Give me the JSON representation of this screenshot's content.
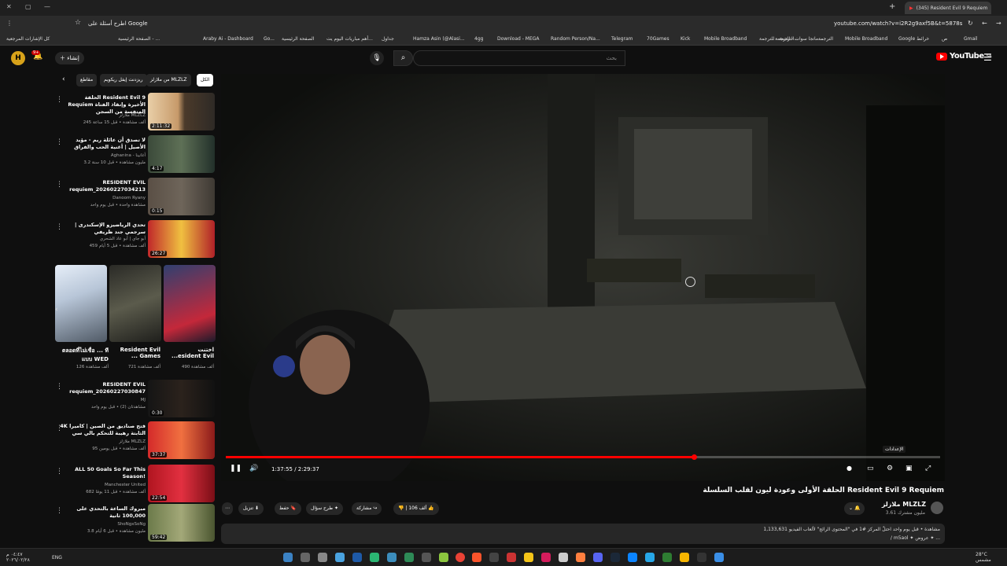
{
  "browser": {
    "tab_title": "(345) Resident Evil 9 Requiem",
    "url": "youtube.com/watch?v=i2R2g9axf5B&t=5878s",
    "ask_google": "اطرح أسئلة على Google",
    "bookmarks": [
      "كل الإشارات المرجعية",
      "الصفحة الرئيسية - ...",
      "Araby Ai - Dashboard",
      "Go...",
      "الصفحة الرئيسية",
      "أهم مباريات اليوم يت...",
      "جداول",
      "Hamza Asin (@Alasi...",
      "4gg",
      "Download - MEGA",
      "Random Person/Na...",
      "Telegram",
      "70Games",
      "Kick",
      "Mobile Broadband",
      "الترجمة - للترجمة...",
      "ماتجا سوات - للترجمة...",
      "الترجمة",
      "Mobile Broadband",
      "Google خرائط",
      "ص",
      "Gmail"
    ]
  },
  "yt": {
    "logo": "YouTube",
    "region": "SA",
    "search_placeholder": "بحث",
    "create_label": "إنشاء",
    "notif_count": "9+",
    "avatar_letter": "H"
  },
  "chips": [
    "الكل",
    "من ملازلز MLZLZ",
    "ريزدنت إيفل ريكويم",
    "مقاطع"
  ],
  "sidebar": [
    {
      "title": "الحلقة Resident Evil 9 Requiem الأخيرة وإنقاذ الفتاة المتفسة من السجن",
      "channel": "ملازلز MLZLZ",
      "meta": "245 ألف مشاهدة • قبل 15 ساعة",
      "duration": "2:11:32"
    },
    {
      "title": "لا تصدق أن عائلة ريم - مؤيد الأصيل | أغنية الحب والفراق",
      "channel": "Aghanina - أغانينا",
      "meta": "3.2 مليون مشاهدة • قبل 10 سنة",
      "duration": "4:17"
    },
    {
      "title": "RESIDENT EVIL requiem_20260227034213",
      "channel": "Danoom Ryany",
      "meta": "مشاهدة واحدة • قبل يوم واحد",
      "duration": "0:15"
    },
    {
      "title": "تحدي الرياضيزو الإسكندرى | سرجمي جند ظريفي",
      "channel": "أبو جاي | أبو عاد الشحري",
      "meta": "459 ألف مشاهدة • قبل 5 أيام",
      "duration": "26:27"
    },
    {
      "title": "RESIDENT EVIL requiem_20260227030847",
      "channel": "MJ",
      "meta": "مشاهدتان (2) • قبل يوم واحد",
      "duration": "0:30"
    },
    {
      "title": "4K فتح صناديق من الصين | كاميرا الثابتة رهيبة للتحكم بالي سي",
      "channel": "ملازلز MLZLZ",
      "meta": "95 ألف مشاهدة • قبل يومين",
      "duration": "37:37"
    },
    {
      "title": "ALL 50 Goals So Far This Season!",
      "channel": "Manchester United",
      "meta": "682 ألف مشاهدة • قبل 11 يومًا",
      "duration": "22:54"
    },
    {
      "title": "مبروك الساعة بالتحدي على 100,000 ثانية",
      "channel": "ShoNgxSoNg",
      "meta": "3.8 مليون مشاهدة • قبل 6 أيام",
      "duration": "59:42"
    }
  ],
  "shorts": [
    {
      "title": "اختنت ...esident Evil",
      "views": "490 ألف مشاهدة"
    },
    {
      "title": "Resident Evil ... Games",
      "views": "721 ألف مشاهدة"
    },
    {
      "title": "ตลอดที่ไม่เชื่อ ... ทีแบบ WED",
      "views": "126 ألف مشاهدة"
    }
  ],
  "player": {
    "time": "1:37:55 / 2:29:37",
    "progress": 0.655,
    "settings_tip": "الإعدادات"
  },
  "video": {
    "title": "الحلقة الأولى وعودة ليون لقلب السلسلة Resident Evil 9 Requiem",
    "channel": "ملازلز MLZLZ",
    "subs": "3.61 مليون مشترك",
    "likes": "106 ألف",
    "share": "مشاركة",
    "ask": "طرح سؤال",
    "save": "حفظ",
    "download": "تنزيل",
    "desc_line1": "1,133,631 مشاهدة • قبل يوم واحد  احتلّ المركز #1 في \"المحتوى الرائج\" لألعاب الفيديو",
    "desc_line2": "/ m5aol ✦ عروض ✦ ..."
  },
  "taskbar": {
    "time": "٠٤:٤٧ م",
    "date": "٢٠٢٦/٠٢/٢٨",
    "lang": "ENG",
    "weather": "28°C",
    "weather_desc": "مشمس"
  }
}
